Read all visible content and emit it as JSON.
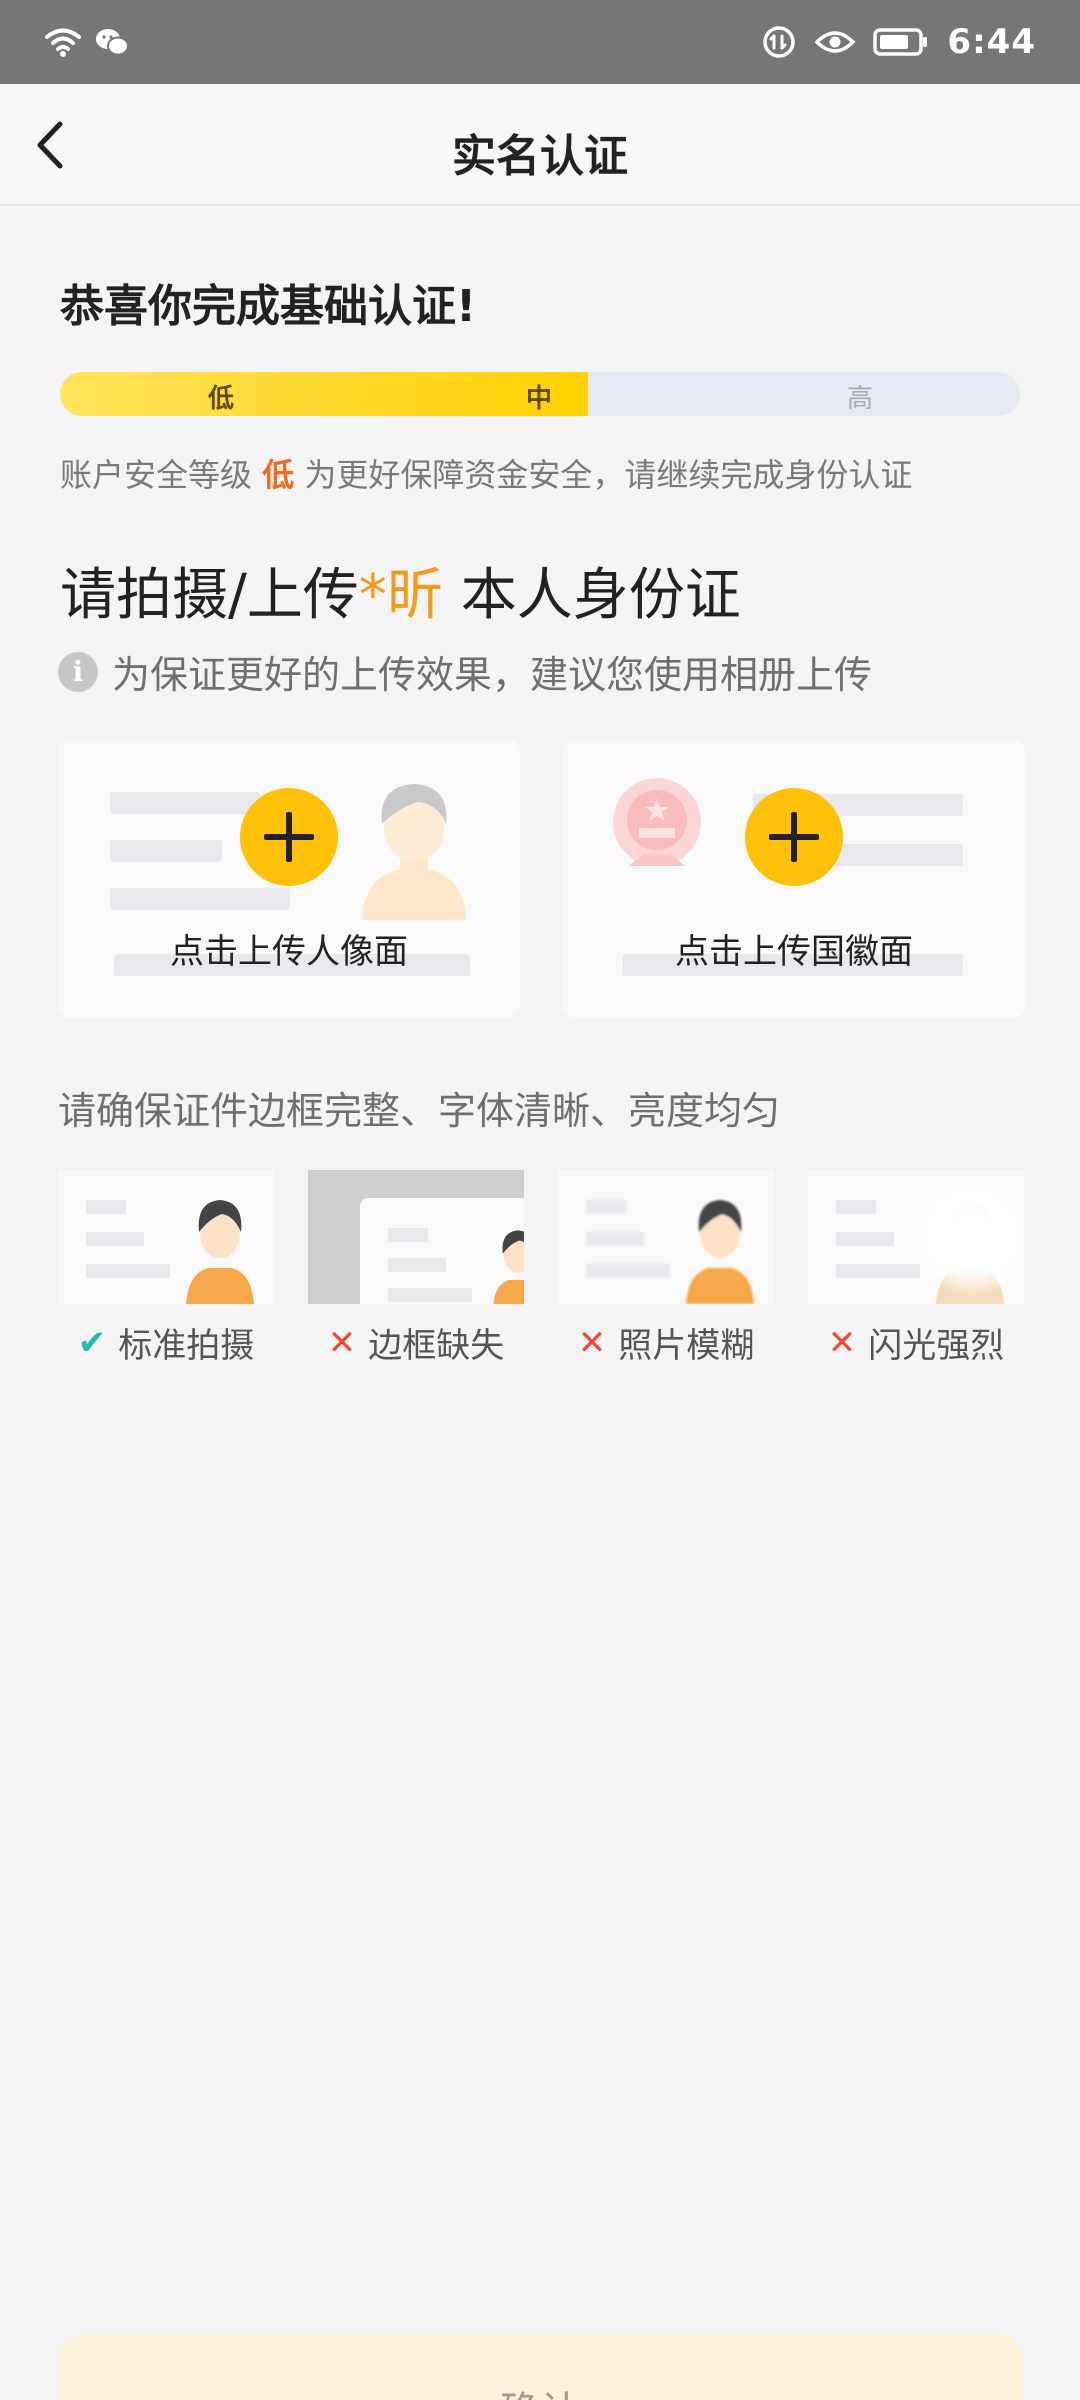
{
  "status_bar": {
    "time": "6:44",
    "icons": [
      "wifi-icon",
      "wechat-icon",
      "data-saver-icon",
      "eye-icon",
      "battery-icon"
    ]
  },
  "nav": {
    "title": "实名认证",
    "back_icon": "chevron-left-icon"
  },
  "congrats": "恭喜你完成基础认证!",
  "security_level": {
    "labels": {
      "low": "低",
      "mid": "中",
      "high": "高"
    },
    "progress": 0.55,
    "text_prefix": "账户安全等级",
    "current_level": "低",
    "text_suffix": "为更好保障资金安全，请继续完成身份认证"
  },
  "upload": {
    "heading_prefix": "请拍摄/上传",
    "heading_mark": "*昕",
    "heading_suffix": "本人身份证",
    "tip": "为保证更好的上传效果，建议您使用相册上传",
    "front_label": "点击上传人像面",
    "back_label": "点击上传国徽面"
  },
  "guide": {
    "text": "请确保证件边框完整、字体清晰、亮度均匀",
    "samples": [
      {
        "label": "标准拍摄",
        "status": "ok"
      },
      {
        "label": "边框缺失",
        "status": "bad"
      },
      {
        "label": "照片模糊",
        "status": "bad"
      },
      {
        "label": "闪光强烈",
        "status": "bad"
      }
    ]
  },
  "confirm_label": "确认",
  "colors": {
    "accent_yellow": "#ffc107",
    "warning_orange": "#f26a19",
    "ok_teal": "#1fbfae",
    "error_red": "#f04a3a"
  }
}
